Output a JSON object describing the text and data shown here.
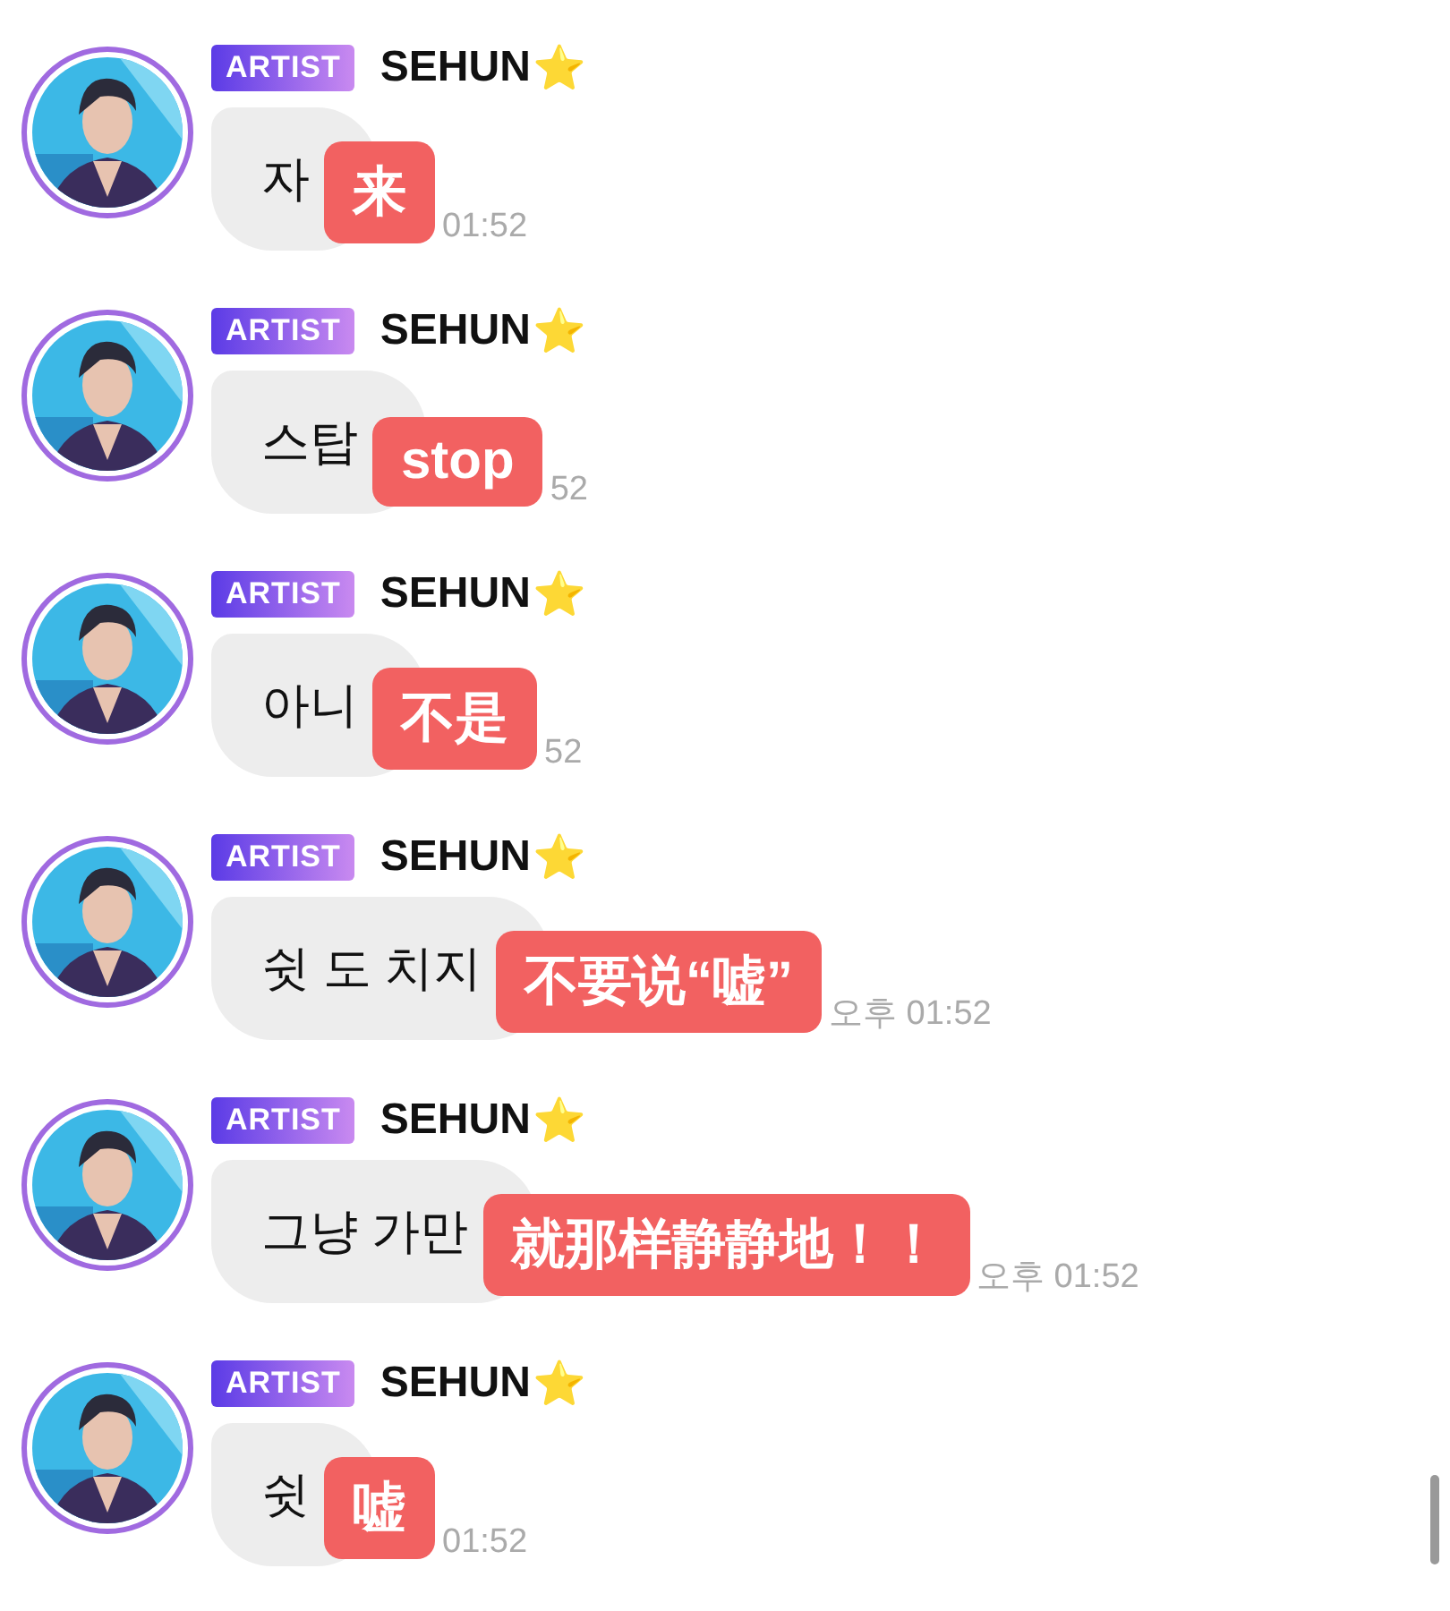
{
  "messages": [
    {
      "badge": "ARTIST",
      "name": "SEHUN",
      "star": "⭐",
      "text": "자",
      "translation": "来",
      "time": "01:52"
    },
    {
      "badge": "ARTIST",
      "name": "SEHUN",
      "star": "⭐",
      "text": "스탑",
      "translation": "stop",
      "time": "52"
    },
    {
      "badge": "ARTIST",
      "name": "SEHUN",
      "star": "⭐",
      "text": "아니",
      "translation": "不是",
      "time": "52"
    },
    {
      "badge": "ARTIST",
      "name": "SEHUN",
      "star": "⭐",
      "text": "쉿 도 치지",
      "translation": "不要说“嘘”",
      "time": "오후 01:52"
    },
    {
      "badge": "ARTIST",
      "name": "SEHUN",
      "star": "⭐",
      "text": "그냥 가만",
      "translation": "就那样静静地！！",
      "time": "오후 01:52"
    },
    {
      "badge": "ARTIST",
      "name": "SEHUN",
      "star": "⭐",
      "text": "쉿",
      "translation": "嘘",
      "time": "01:52"
    }
  ]
}
